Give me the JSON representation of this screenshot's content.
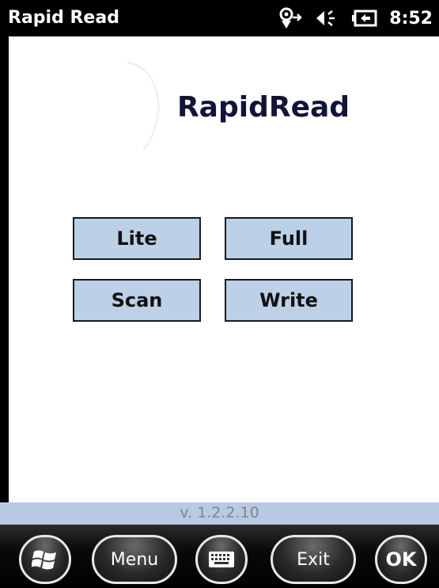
{
  "titlebar": {
    "title": "Rapid Read",
    "time": "8:52",
    "icons": [
      "connectivity-icon",
      "volume-icon",
      "battery-icon"
    ]
  },
  "main": {
    "logo": "RapidRead",
    "buttons": {
      "lite": "Lite",
      "full": "Full",
      "scan": "Scan",
      "write": "Write"
    }
  },
  "version": "v. 1.2.2.10",
  "softkeys": {
    "start_icon": "windows-start-icon",
    "menu": "Menu",
    "keyboard_icon": "keyboard-icon",
    "exit": "Exit",
    "ok": "OK"
  },
  "colors": {
    "button_fill": "#bcd0e8",
    "logo_text": "#101438",
    "version_bar": "#b9cbe3"
  }
}
